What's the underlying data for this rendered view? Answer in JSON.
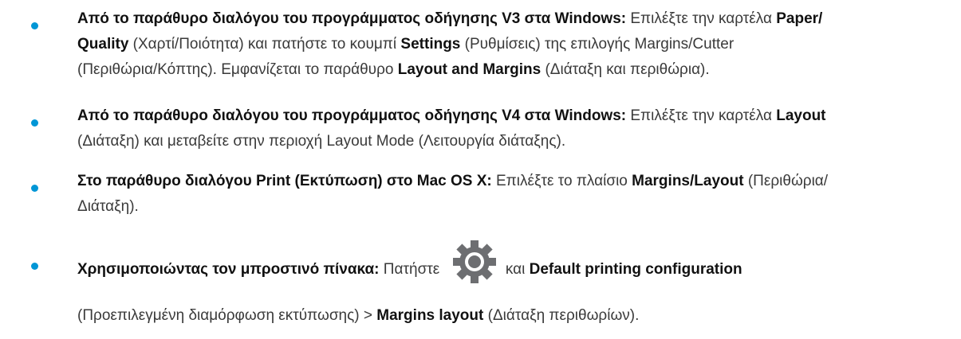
{
  "items": [
    {
      "lines": [
        [
          {
            "t": "Από το παράθυρο διαλόγου του προγράμματος οδήγησης V3 στα Windows:",
            "b": true
          },
          {
            "t": " Επιλέξτε την καρτέλα ",
            "b": false
          },
          {
            "t": "Paper/",
            "b": true
          }
        ],
        [
          {
            "t": "Quality",
            "b": true
          },
          {
            "t": " (Χαρτί/Ποιότητα) και πατήστε το κουμπί ",
            "b": false
          },
          {
            "t": "Settings",
            "b": true
          },
          {
            "t": " (Ρυθμίσεις) της επιλογής Margins/Cutter",
            "b": false
          }
        ],
        [
          {
            "t": "(Περιθώρια/Κόπτης). Εμφανίζεται το παράθυρο ",
            "b": false
          },
          {
            "t": "Layout and Margins",
            "b": true
          },
          {
            "t": " (Διάταξη και περιθώρια).",
            "b": false
          }
        ]
      ]
    },
    {
      "lines": [
        [
          {
            "t": "Από το παράθυρο διαλόγου του προγράμματος οδήγησης V4 στα Windows:",
            "b": true
          },
          {
            "t": " Επιλέξτε την καρτέλα ",
            "b": false
          },
          {
            "t": "Layout",
            "b": true
          }
        ],
        [
          {
            "t": "(Διάταξη) και μεταβείτε στην περιοχή Layout Mode (Λειτουργία διάταξης).",
            "b": false
          }
        ]
      ]
    },
    {
      "lines": [
        [
          {
            "t": "Στο παράθυρο διαλόγου Print (Εκτύπωση) στο Mac OS X:",
            "b": true
          },
          {
            "t": " Επιλέξτε το πλαίσιο ",
            "b": false
          },
          {
            "t": "Margins/Layout",
            "b": true
          },
          {
            "t": " (Περιθώρια/",
            "b": false
          }
        ],
        [
          {
            "t": "Διάταξη).",
            "b": false
          }
        ]
      ]
    },
    {
      "icon": "settings-gear-icon",
      "lines": [
        [
          {
            "t": "Χρησιμοποιώντας τον μπροστινό πίνακα:",
            "b": true
          },
          {
            "t": " Πατήστε ",
            "b": false
          },
          {
            "icon": true
          },
          {
            "t": " και ",
            "b": false
          },
          {
            "t": "Default printing configuration",
            "b": true
          }
        ],
        [
          {
            "t": "(Προεπιλεγμένη διαμόρφωση εκτύπωσης) > ",
            "b": false
          },
          {
            "t": "Margins layout",
            "b": true
          },
          {
            "t": " (Διάταξη περιθωρίων).",
            "b": false
          }
        ]
      ]
    }
  ],
  "colors": {
    "bullet": "#0096d6",
    "text": "#2b2b2b",
    "bold": "#111111",
    "gear": "#6d6e71"
  }
}
